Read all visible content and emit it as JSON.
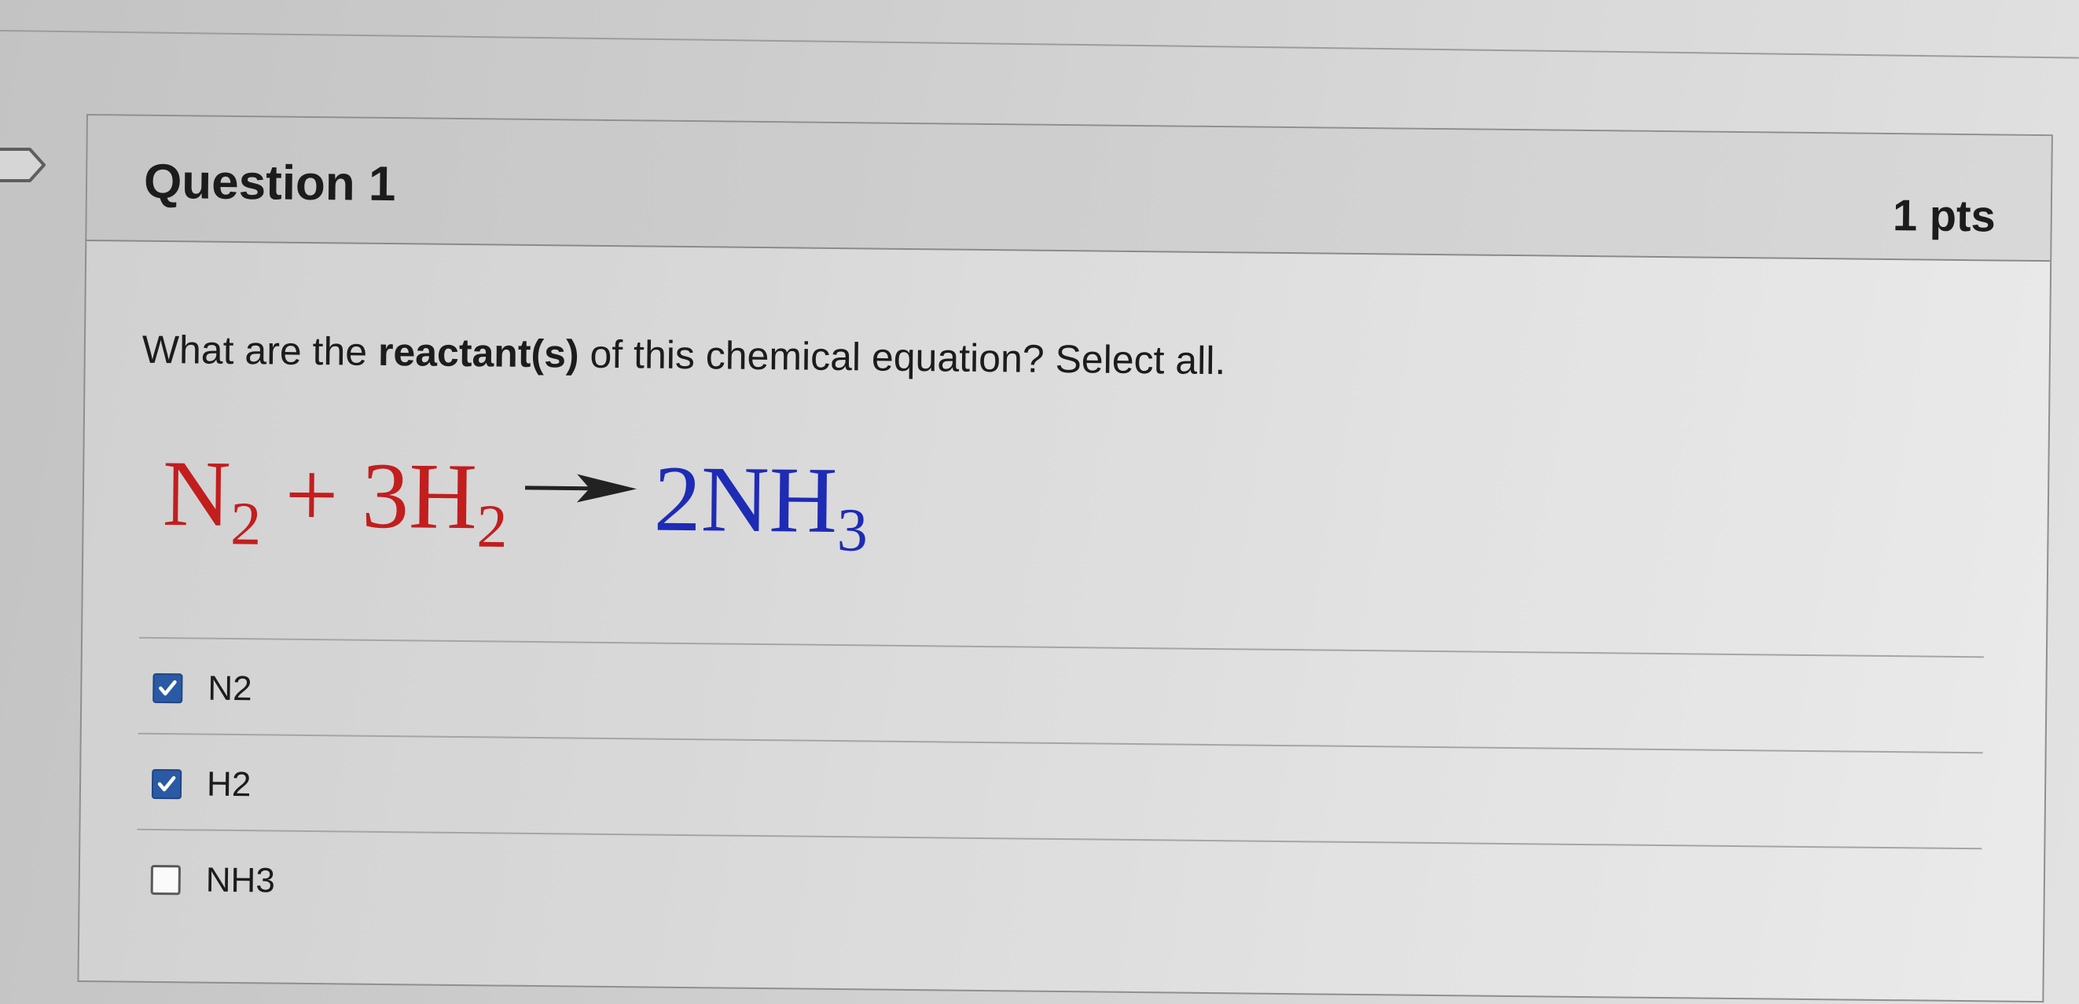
{
  "question": {
    "title": "Question 1",
    "points": "1 pts",
    "prompt_before": "What are the ",
    "prompt_bold": "reactant(s)",
    "prompt_after": " of this chemical equation? Select all."
  },
  "equation": {
    "reactant1_symbol": "N",
    "reactant1_sub": "2",
    "plus": "+",
    "reactant2_symbol": "3H",
    "reactant2_sub": "2",
    "product_symbol": "2NH",
    "product_sub": "3",
    "colors": {
      "reactants": "#c21e1e",
      "products": "#1e2bb5"
    }
  },
  "answers": [
    {
      "label": "N2",
      "checked": true
    },
    {
      "label": "H2",
      "checked": true
    },
    {
      "label": "NH3",
      "checked": false
    }
  ],
  "icons": {
    "flag": "flag-icon",
    "check": "checkmark-icon"
  }
}
